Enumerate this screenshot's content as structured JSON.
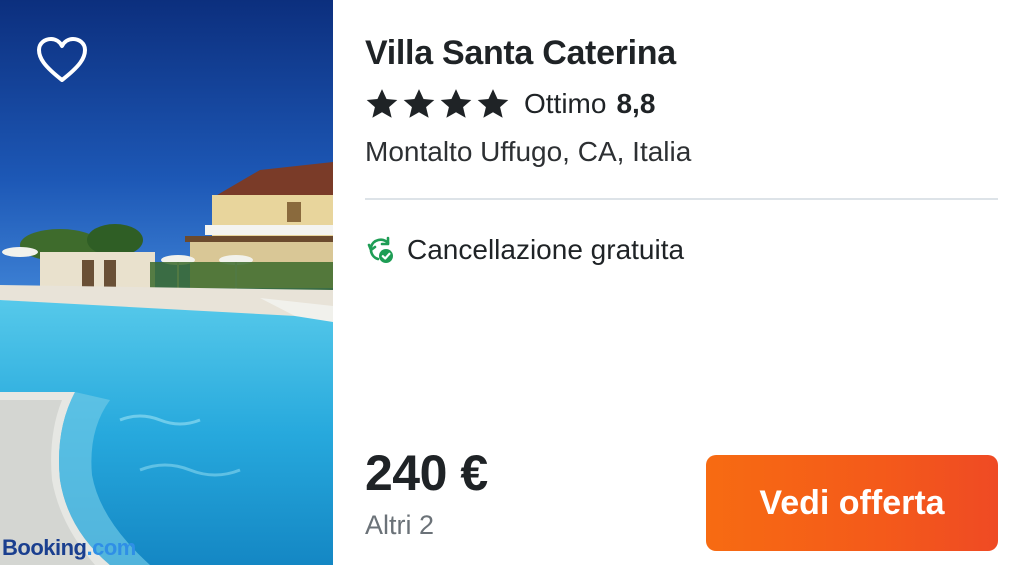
{
  "hotel": {
    "name": "Villa Santa Caterina",
    "stars": 4,
    "rating_label": "Ottimo",
    "rating_score": "8,8",
    "location": "Montalto Uffugo, CA, Italia"
  },
  "perks": {
    "free_cancellation": "Cancellazione gratuita"
  },
  "pricing": {
    "price": "240 €",
    "others": "Altri 2"
  },
  "cta": {
    "label": "Vedi offerta"
  },
  "image": {
    "watermark_main": "Booking",
    "watermark_suffix": ".com"
  },
  "icons": {
    "favorite": "heart-outline-icon",
    "star": "star-icon",
    "cancellation": "refresh-check-icon"
  },
  "colors": {
    "cta": "#f45a1a",
    "check_green": "#1e9d55",
    "text": "#1f2326",
    "muted": "#6b7278"
  }
}
